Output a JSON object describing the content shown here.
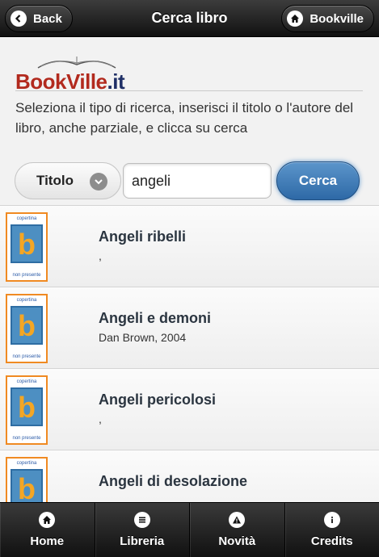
{
  "header": {
    "title": "Cerca libro",
    "back_label": "Back",
    "home_label": "Bookville"
  },
  "logo": {
    "brand": "BookVille",
    "suffix": ".it"
  },
  "intro_text": "Seleziona il tipo di ricerca, inserisci il titolo o l'autore del libro, anche parziale, e clicca su cerca",
  "search": {
    "type_selected": "Titolo",
    "query": "angeli",
    "submit_label": "Cerca"
  },
  "cover_placeholder": {
    "top": "copertina",
    "letter": "b",
    "bottom": "non presente"
  },
  "results": [
    {
      "title": "Angeli ribelli",
      "subtitle": ","
    },
    {
      "title": "Angeli e demoni",
      "subtitle": "Dan Brown, 2004"
    },
    {
      "title": "Angeli pericolosi",
      "subtitle": ","
    },
    {
      "title": "Angeli di desolazione",
      "subtitle": ""
    }
  ],
  "footer": {
    "tabs": [
      {
        "label": "Home",
        "icon": "home-icon"
      },
      {
        "label": "Libreria",
        "icon": "list-icon"
      },
      {
        "label": "Novità",
        "icon": "alert-icon"
      },
      {
        "label": "Credits",
        "icon": "info-icon"
      }
    ]
  },
  "colors": {
    "accent_blue": "#2e69a6",
    "brand_red": "#b22a1e",
    "brand_navy": "#1f2f66",
    "cover_orange": "#f08a22"
  }
}
